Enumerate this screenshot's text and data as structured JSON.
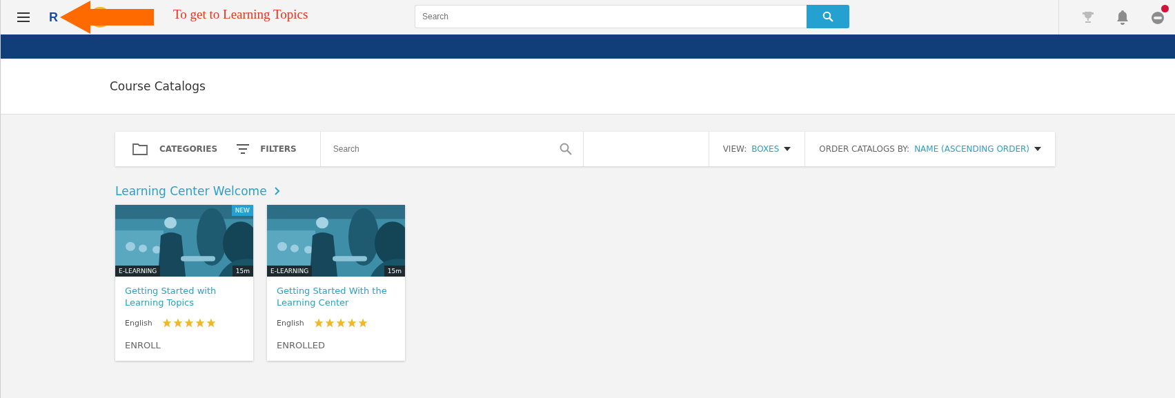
{
  "header": {
    "logo_text": "R",
    "search": {
      "placeholder": "Search"
    },
    "notification_dot": true
  },
  "annotation": {
    "text": "To get to Learning Topics"
  },
  "page": {
    "title": "Course Catalogs"
  },
  "toolbar": {
    "categories": "CATEGORIES",
    "filters": "FILTERS",
    "search": {
      "placeholder": "Search"
    },
    "view_label": "VIEW:",
    "view_value": "BOXES",
    "order_label": "ORDER CATALOGS BY:",
    "order_value": "NAME (ASCENDING ORDER)"
  },
  "section": {
    "title": "Learning Center Welcome"
  },
  "courses": [
    {
      "badge": "NEW",
      "type": "E-LEARNING",
      "duration": "15m",
      "title": "Getting Started with Learning Topics",
      "language": "English",
      "stars": 5,
      "action": "ENROLL"
    },
    {
      "type": "E-LEARNING",
      "duration": "15m",
      "title": "Getting Started With the Learning Center",
      "language": "English",
      "stars": 5,
      "action": "ENROLLED"
    }
  ]
}
